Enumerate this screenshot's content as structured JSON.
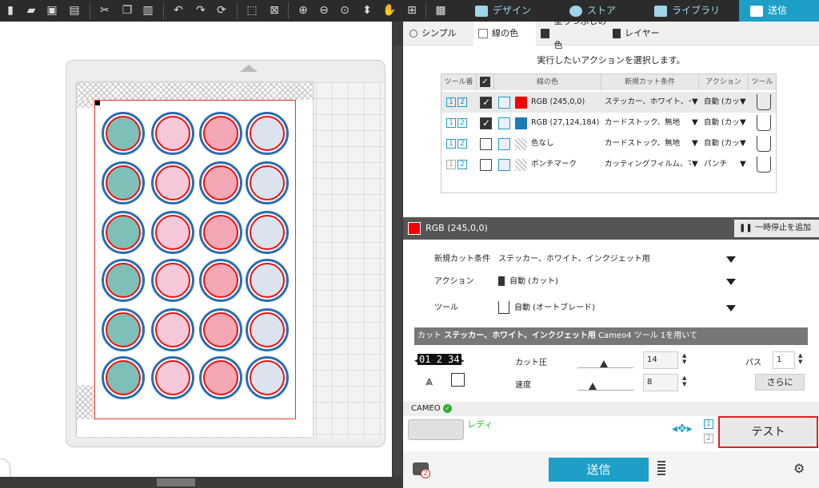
{
  "topbar": {
    "tabs": [
      {
        "label": "デザイン"
      },
      {
        "label": "ストア"
      },
      {
        "label": "ライブラリ"
      },
      {
        "label": "送信"
      }
    ]
  },
  "panel_tabs": [
    {
      "label": "シンプル"
    },
    {
      "label": "線の色"
    },
    {
      "label": "塗りつぶしの色"
    },
    {
      "label": "レイヤー"
    }
  ],
  "instruction": "実行したいアクションを選択します。",
  "table": {
    "headers": [
      "ツール番号",
      "線の色",
      "新規カット条件",
      "アクション",
      "ツール"
    ],
    "rows": [
      {
        "tool": [
          "1",
          "2"
        ],
        "checked": true,
        "color": "#f50000",
        "color_label": "RGB (245,0,0)",
        "condition": "ステッカー、ホワイト、イン:",
        "action": "自動 (カッ!"
      },
      {
        "tool": [
          "1",
          "2"
        ],
        "checked": true,
        "color": "#1b7cb8",
        "color_label": "RGB (27,124,184)",
        "condition": "カードストック、無地",
        "action": "自動 (カッ!"
      },
      {
        "tool": [
          "1",
          "2"
        ],
        "checked": false,
        "color": "none",
        "color_label": "色なし",
        "condition": "カードストック、無地",
        "action": "自動 (カッ!"
      },
      {
        "tool": [
          "1",
          "2"
        ],
        "checked": false,
        "color": "none",
        "color_label": "ポンチマーク",
        "condition": "カッティングフィルム、マッ!",
        "action": "パンチ"
      }
    ]
  },
  "selected_color": {
    "swatch": "#f50000",
    "label": "RGB (245,0,0)"
  },
  "pause_button": "一時停止を追加",
  "form": {
    "condition_label": "新規カット条件",
    "condition_value": "ステッカー、ホワイト、インクジェット用",
    "action_label": "アクション",
    "action_value": "自動 (カット)",
    "tool_label": "ツール",
    "tool_value": "自動 (オートブレード)"
  },
  "cut_bar": {
    "prefix": "カット",
    "material": "ステッカー、ホワイト、インクジェット用",
    "suffix": "Cameo4 ツール 1を用いて"
  },
  "blade_digits": "01 2 34",
  "cut_pressure": {
    "label": "カット圧",
    "value": "14"
  },
  "speed": {
    "label": "速度",
    "value": "8"
  },
  "pass": {
    "label": "パス",
    "value": "1"
  },
  "more_button": "さらに",
  "device": {
    "name": "CAMEO",
    "status": "レディ"
  },
  "test_button": "テスト",
  "send_button": "送信",
  "badge": "2",
  "tool_nums": [
    "1",
    "2"
  ],
  "accent": "#1e9fc8"
}
